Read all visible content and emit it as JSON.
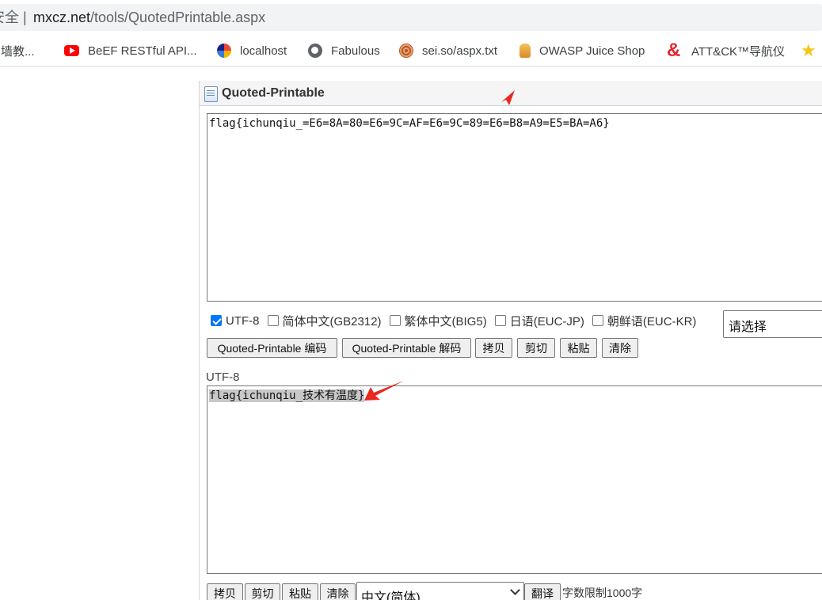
{
  "browser": {
    "security_label": "安全",
    "url_host": "mxcz.net",
    "url_path": "/tools/QuotedPrintable.aspx",
    "bookmarks": [
      {
        "label": "翻墙教...",
        "icon": "folder-icon"
      },
      {
        "label": "BeEF RESTful API...",
        "icon": "youtube-icon"
      },
      {
        "label": "localhost",
        "icon": "localhost-icon"
      },
      {
        "label": "Fabulous",
        "icon": "globe-icon"
      },
      {
        "label": "sei.so/aspx.txt",
        "icon": "sei-icon"
      },
      {
        "label": "OWASP Juice Shop",
        "icon": "owasp-icon"
      },
      {
        "label": "ATT&CK™导航仪",
        "icon": "attck-icon"
      },
      {
        "label": "",
        "icon": "star-icon"
      }
    ]
  },
  "tool": {
    "title": "Quoted-Printable",
    "input_text": "flag{ichunqiu_=E6=8A=80=E6=9C=AF=E6=9C=89=E6=B8=A9=E5=BA=A6}",
    "charsets": [
      {
        "label": "UTF-8",
        "checked": true
      },
      {
        "label": "简体中文(GB2312)",
        "checked": false
      },
      {
        "label": "繁体中文(BIG5)",
        "checked": false
      },
      {
        "label": "日语(EUC-JP)",
        "checked": false
      },
      {
        "label": "朝鲜语(EUC-KR)",
        "checked": false
      }
    ],
    "charset_select": "请选择",
    "buttons": {
      "encode": "Quoted-Printable 编码",
      "decode": "Quoted-Printable 解码",
      "copy": "拷贝",
      "cut": "剪切",
      "paste": "粘贴",
      "clear": "清除"
    },
    "output_label": "UTF-8",
    "output_text": "flag{ichunqiu_技术有温度}",
    "bottom_buttons": {
      "copy": "拷贝",
      "cut": "剪切",
      "paste": "粘贴",
      "clear": "清除",
      "translate": "翻译"
    },
    "language_select": "中文(简体)",
    "limit_text": "字数限制1000字"
  },
  "colors": {
    "annotation_arrow": "#e8271f",
    "checkbox_accent": "#0075ff"
  }
}
